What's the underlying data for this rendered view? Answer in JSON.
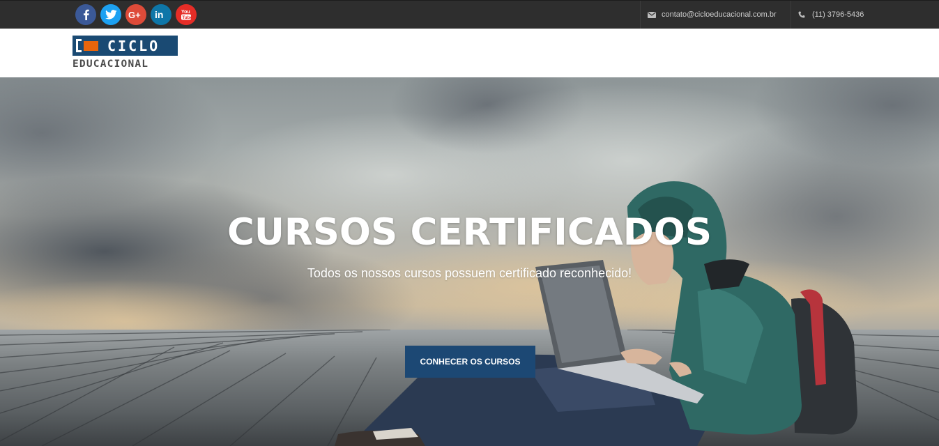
{
  "social": {
    "items": [
      {
        "name": "facebook",
        "icon": "facebook-icon",
        "color": "#3b5998"
      },
      {
        "name": "twitter",
        "icon": "twitter-icon",
        "color": "#1da1f2"
      },
      {
        "name": "google-plus",
        "icon": "google-plus-icon",
        "color": "#dd4b39"
      },
      {
        "name": "linkedin",
        "icon": "linkedin-icon",
        "color": "#0e76a8"
      },
      {
        "name": "youtube",
        "icon": "youtube-icon",
        "color": "#e52d27"
      }
    ]
  },
  "contact": {
    "email": "contato@cicloeducacional.com.br",
    "email_icon": "envelope-icon",
    "phone": "(11) 3796-5436",
    "phone_icon": "phone-icon"
  },
  "logo": {
    "word": "CICLO",
    "subword": "EDUCACIONAL",
    "colors": {
      "navy": "#1a4a73",
      "orange": "#e8650c",
      "gray": "#4b4b4b"
    }
  },
  "hero": {
    "title": "CURSOS CERTIFICADOS",
    "subtitle": "Todos os nossos cursos possuem certificado reconhecido!",
    "cta_label": "CONHECER OS CURSOS",
    "cta_color": "#1c4874"
  }
}
